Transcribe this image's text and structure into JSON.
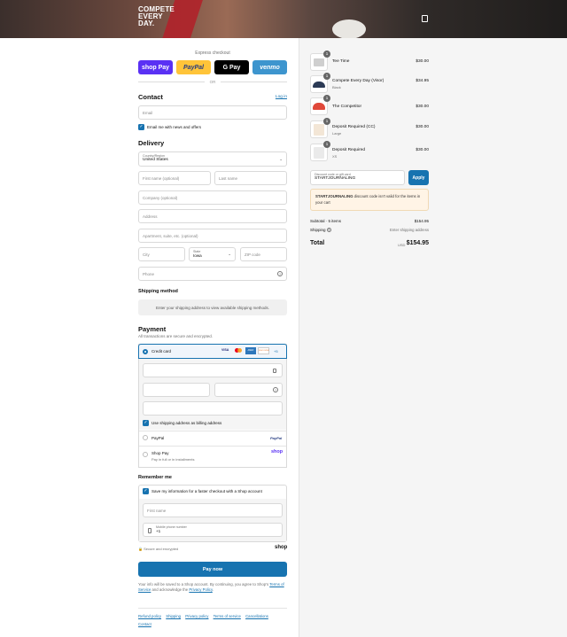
{
  "header": {
    "logo_lines": [
      "COMPETE",
      "EVERY",
      "DAY."
    ]
  },
  "express": {
    "title": "Express checkout",
    "buttons": [
      {
        "label": "shop Pay",
        "color": "#5a31f4",
        "text": "#ffffff"
      },
      {
        "label": "PayPal",
        "color": "#ffc439",
        "text": "#253b80"
      },
      {
        "label": "G Pay",
        "color": "#000000",
        "text": "#ffffff"
      },
      {
        "label": "venmo",
        "color": "#3d95ce",
        "text": "#ffffff"
      }
    ],
    "or": "OR"
  },
  "contact": {
    "title": "Contact",
    "login": "Log in",
    "email_placeholder": "Email",
    "news_label": "Email me with news and offers"
  },
  "delivery": {
    "title": "Delivery",
    "country_label": "Country/Region",
    "country_value": "United States",
    "first_name": "First name (optional)",
    "last_name": "Last name",
    "company": "Company (optional)",
    "address": "Address",
    "apartment": "Apartment, suite, etc. (optional)",
    "city": "City",
    "state_label": "State",
    "state_value": "Iowa",
    "zip": "ZIP code",
    "phone": "Phone"
  },
  "shipping": {
    "title": "Shipping method",
    "note": "Enter your shipping address to view available shipping methods."
  },
  "payment": {
    "title": "Payment",
    "subtitle": "All transactions are secure and encrypted.",
    "credit_card": "Credit card",
    "cards": [
      "VISA",
      "MC",
      "AMEX",
      "DISCOVER",
      "+5"
    ],
    "billing_label": "Use shipping address as billing address",
    "paypal": "PayPal",
    "paypal_logo": "PayPal",
    "shoppay": "Shop Pay",
    "shoppay_sub": "Pay in full or in installments",
    "shoppay_logo": "shop"
  },
  "remember": {
    "title": "Remember me",
    "save_label": "Save my information for a faster checkout with a Shop account",
    "first_name": "First name",
    "phone_label": "Mobile phone number",
    "phone_value": "+1",
    "secure": "Secure and encrypted",
    "shop": "shop"
  },
  "pay_now": "Pay now",
  "disclaimer": {
    "text1": "Your info will be saved to a Shop account. By continuing, you agree to Shop's",
    "terms": "Terms of Service",
    "text2": "and acknowledge the",
    "privacy": "Privacy Policy"
  },
  "footer": [
    "Refund policy",
    "Shipping",
    "Privacy policy",
    "Terms of service",
    "Cancellations",
    "Contact"
  ],
  "cart": {
    "items": [
      {
        "name": "Tee Time",
        "variant": "",
        "price": "$30.00",
        "qty": "1",
        "color": "#dddddd"
      },
      {
        "name": "Compete Every Day (Visor)",
        "variant": "Black",
        "price": "$34.95",
        "qty": "1",
        "color": "#2b3a55"
      },
      {
        "name": "The Competitor",
        "variant": "",
        "price": "$30.00",
        "qty": "1",
        "color": "#e0483a"
      },
      {
        "name": "Deposit Required (CC)",
        "variant": "Large",
        "price": "$30.00",
        "qty": "1",
        "color": "#f3e6d6"
      },
      {
        "name": "Deposit Required",
        "variant": "XS",
        "price": "$30.00",
        "qty": "1",
        "color": "#eeeeee"
      }
    ],
    "discount_label": "Discount code or gift card",
    "discount_value": "STARTJOURNALING",
    "apply": "Apply",
    "error_code": "STARTJOURNALING",
    "error_text": "discount code isn't valid for the items in your cart",
    "subtotal_label": "Subtotal · 5 items",
    "subtotal_value": "$154.95",
    "shipping_label": "Shipping",
    "shipping_value": "Enter shipping address",
    "total_label": "Total",
    "currency": "USD",
    "total_value": "$154.95"
  }
}
